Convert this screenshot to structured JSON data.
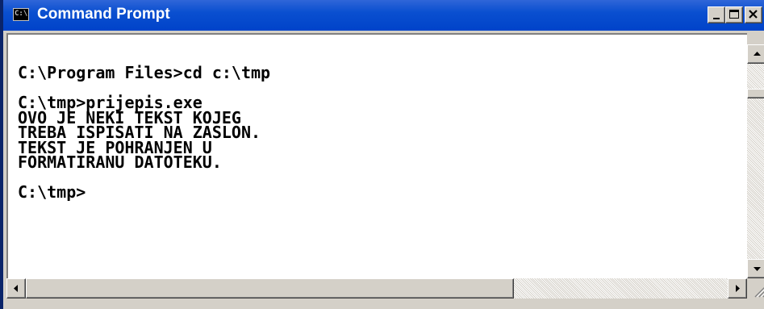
{
  "window": {
    "title": "Command Prompt",
    "app_icon_text": "C:\\"
  },
  "console": {
    "lines": [
      "C:\\Program Files>cd c:\\tmp",
      "",
      "C:\\tmp>prijepis.exe",
      "OVO JE NEKI TEKST KOJEG",
      "TREBA ISPISATI NA ZASLON.",
      "TEKST JE POHRANJEN U",
      "FORMATIRANU DATOTEKU.",
      "",
      "C:\\tmp>"
    ]
  },
  "icons": {
    "minimize": "minimize-icon",
    "maximize": "maximize-icon",
    "close": "close-icon",
    "scroll_up": "arrow-up-icon",
    "scroll_down": "arrow-down-icon",
    "scroll_left": "arrow-left-icon",
    "scroll_right": "arrow-right-icon"
  },
  "colors": {
    "titlebar": "#0a4fd0",
    "title_text": "#ffffff",
    "console_bg": "#ffffff",
    "console_text": "#000000",
    "chrome": "#d4d0c8"
  }
}
